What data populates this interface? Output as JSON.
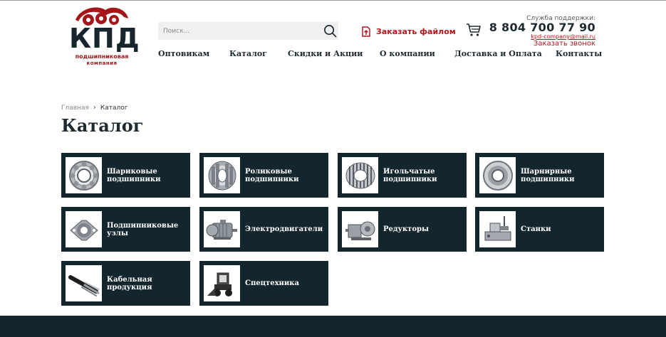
{
  "header": {
    "logo": {
      "main": "КПД",
      "sub1": "подшипниковая",
      "sub2": "компания",
      "brand_color": "#a5161b"
    },
    "search": {
      "placeholder": "Поиск...",
      "icon": "search-icon"
    },
    "order_file": {
      "label": "Заказать файлом",
      "icon": "file-upload-icon"
    },
    "cart": {
      "icon": "cart-icon"
    },
    "support": {
      "label": "Служба поддержки:",
      "phone": "8 804 700 77 90",
      "email": "kpd-company@mail.ru",
      "callback": "Заказать звонок"
    },
    "nav": [
      {
        "label": "Оптовикам"
      },
      {
        "label": "Каталог"
      },
      {
        "label": "Скидки и Акции"
      },
      {
        "label": "О компании"
      },
      {
        "label": "Доставка и Оплата"
      },
      {
        "label": "Контакты"
      }
    ]
  },
  "breadcrumb": {
    "home": "Главная",
    "current": "Каталог"
  },
  "page_title": "Каталог",
  "catalog": [
    {
      "label": "Шариковые подшипники",
      "icon": "ball-bearing-image"
    },
    {
      "label": "Роликовые подшипники",
      "icon": "roller-bearing-image"
    },
    {
      "label": "Игольчатые подшипники",
      "icon": "needle-bearing-image"
    },
    {
      "label": "Шарнирные подшипники",
      "icon": "spherical-bearing-image"
    },
    {
      "label": "Подшипниковые узлы",
      "icon": "bearing-unit-image"
    },
    {
      "label": "Электродвигатели",
      "icon": "electric-motor-image"
    },
    {
      "label": "Редукторы",
      "icon": "gearbox-image"
    },
    {
      "label": "Станки",
      "icon": "machine-tool-image"
    },
    {
      "label": "Кабельная продукция",
      "icon": "cable-image"
    },
    {
      "label": "Спецтехника",
      "icon": "skid-steer-image"
    }
  ],
  "colors": {
    "dark": "#13262d",
    "accent": "#b3161c"
  }
}
